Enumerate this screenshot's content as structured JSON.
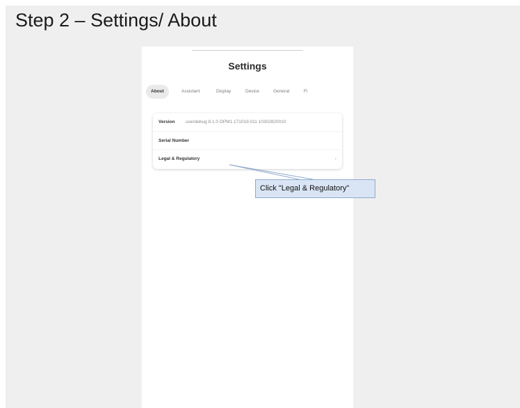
{
  "step": {
    "title": "Step 2 – Settings/ About"
  },
  "screen": {
    "title": "Settings",
    "tabs": [
      {
        "label": "About",
        "active": true
      },
      {
        "label": "Assistant",
        "active": false
      },
      {
        "label": "Display",
        "active": false
      },
      {
        "label": "Device",
        "active": false
      },
      {
        "label": "General",
        "active": false
      },
      {
        "label": "Fi",
        "active": false
      }
    ],
    "rows": {
      "version_label": "Version",
      "version_value": "userdebug 8.1.0 OPM1.171019.011 10302820010",
      "serial_label": "Serial Number",
      "legal_label": "Legal & Regulatory",
      "legal_icon": "chevron-right-icon"
    }
  },
  "callout": {
    "text": "Click \"Legal & Regulatory\""
  },
  "colors": {
    "slide_bg": "#efefef",
    "callout_bg": "#d9e5f4",
    "callout_border": "#8fa9cc"
  }
}
